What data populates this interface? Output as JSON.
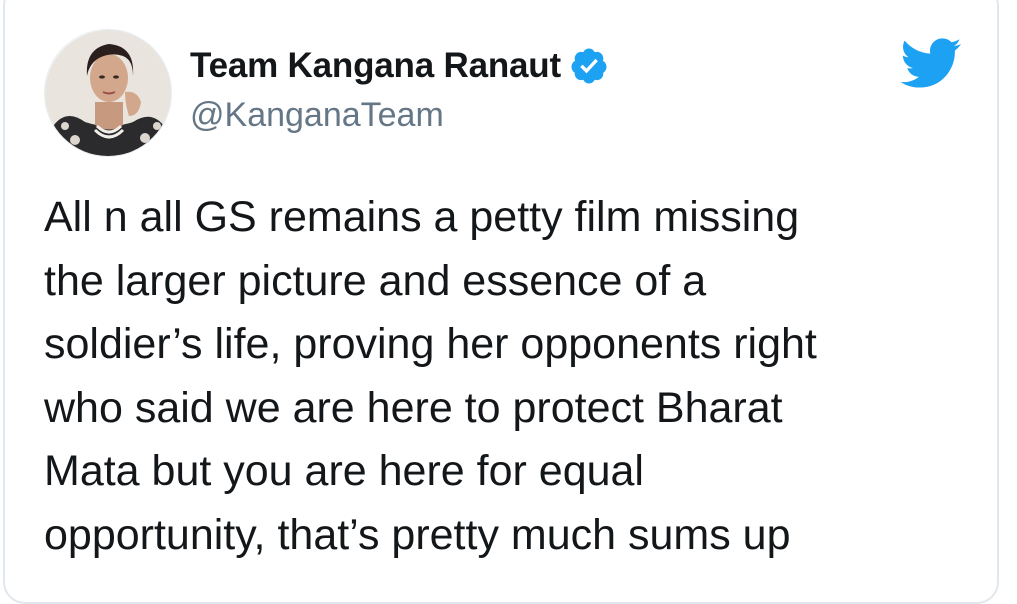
{
  "author": {
    "display_name": "Team Kangana Ranaut",
    "handle": "@KanganaTeam",
    "verified": true,
    "avatar_icon": "profile-photo"
  },
  "brand": {
    "icon": "twitter-bird-icon",
    "color": "#1da1f2"
  },
  "tweet": {
    "lines": [
      "All n all GS remains a petty film missing",
      "the larger picture and essence of a",
      "soldier’s life, proving her opponents right",
      "who said we are here to protect Bharat",
      "Mata but you are here for equal",
      "opportunity, that’s pretty much sums up"
    ]
  },
  "colors": {
    "text": "#14171a",
    "secondary": "#657786",
    "verified_badge": "#1da1f2",
    "card_border": "#e1e8ed"
  }
}
